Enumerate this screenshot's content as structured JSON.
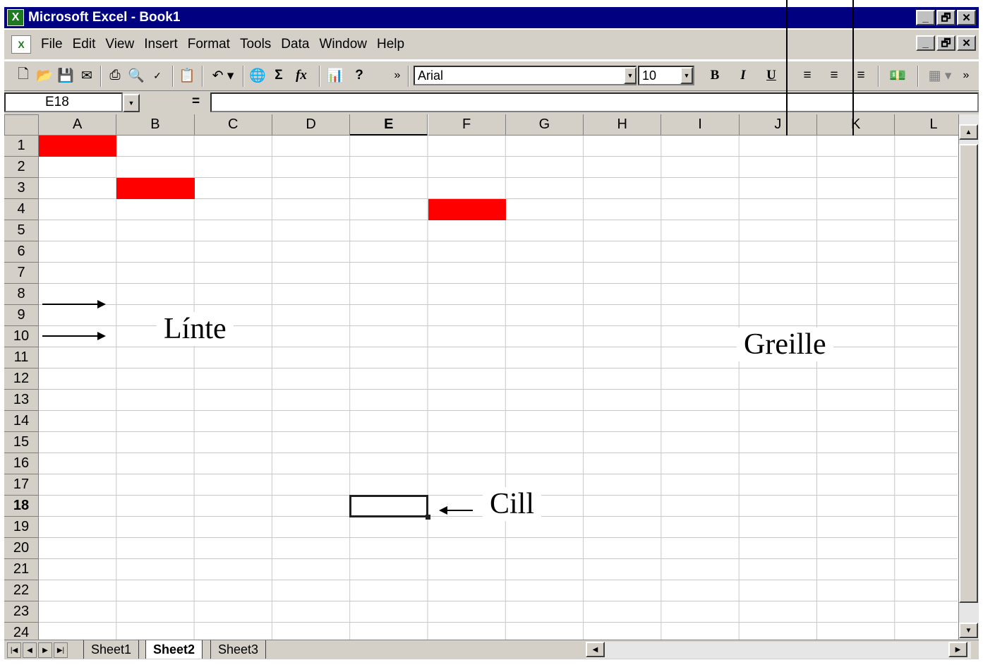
{
  "window": {
    "title": "Microsoft Excel - Book1",
    "controls": [
      "_",
      "🗗",
      "✕"
    ]
  },
  "menu": {
    "items": [
      {
        "label": "File"
      },
      {
        "label": "Edit"
      },
      {
        "label": "View"
      },
      {
        "label": "Insert"
      },
      {
        "label": "Format"
      },
      {
        "label": "Tools"
      },
      {
        "label": "Data"
      },
      {
        "label": "Window"
      },
      {
        "label": "Help"
      }
    ]
  },
  "toolbar": {
    "font_name": "Arial",
    "font_size": "10",
    "sum_glyph": "Σ",
    "fx_glyph": "fx",
    "bold_glyph": "B",
    "italic_glyph": "I",
    "underline_glyph": "U",
    "more_glyph": "»"
  },
  "formula_bar": {
    "cell_ref": "E18",
    "equals": "=",
    "value": ""
  },
  "grid": {
    "columns": [
      "A",
      "B",
      "C",
      "D",
      "E",
      "F",
      "G",
      "H",
      "I",
      "J",
      "K",
      "L"
    ],
    "rows": [
      "1",
      "2",
      "3",
      "4",
      "5",
      "6",
      "7",
      "8",
      "9",
      "10",
      "11",
      "12",
      "13",
      "14",
      "15",
      "16",
      "17",
      "18",
      "19",
      "20",
      "21",
      "22",
      "23",
      "24"
    ],
    "active_column": "E",
    "active_row": "18",
    "highlight_color": "#ff0000",
    "highlighted_cells": [
      "A1",
      "B3",
      "F4"
    ]
  },
  "sheets": {
    "tabs": [
      {
        "label": "Sheet1",
        "active": false
      },
      {
        "label": "Sheet2",
        "active": true
      },
      {
        "label": "Sheet3",
        "active": false
      }
    ]
  },
  "annotations": {
    "row_label": "Línte",
    "grid_label": "Greille",
    "cell_label": "Cill"
  }
}
